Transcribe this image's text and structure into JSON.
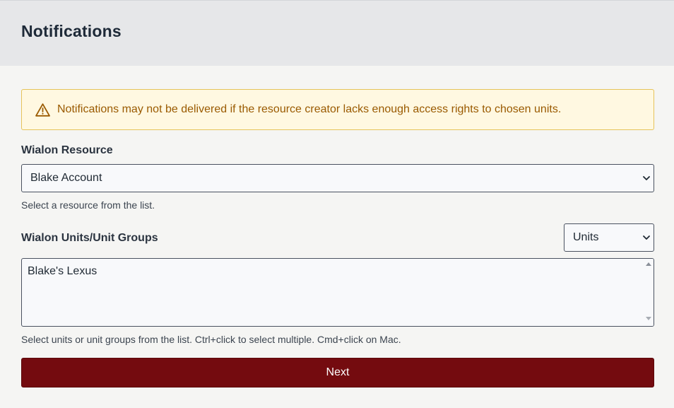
{
  "header": {
    "title": "Notifications"
  },
  "alert": {
    "icon": "warning-triangle-icon",
    "text": "Notifications may not be delivered if the resource creator lacks enough access rights to chosen units.",
    "color": "#9a5a00",
    "background": "#fff8e1",
    "border": "#e6c35a"
  },
  "resource": {
    "label": "Wialon Resource",
    "selected": "Blake Account",
    "help": "Select a resource from the list."
  },
  "units": {
    "label": "Wialon Units/Unit Groups",
    "type_selected": "Units",
    "options": [
      "Blake's Lexus"
    ],
    "help": "Select units or unit groups from the list. Ctrl+click to select multiple. Cmd+click on Mac."
  },
  "actions": {
    "next_label": "Next",
    "next_color": "#740b0f"
  }
}
